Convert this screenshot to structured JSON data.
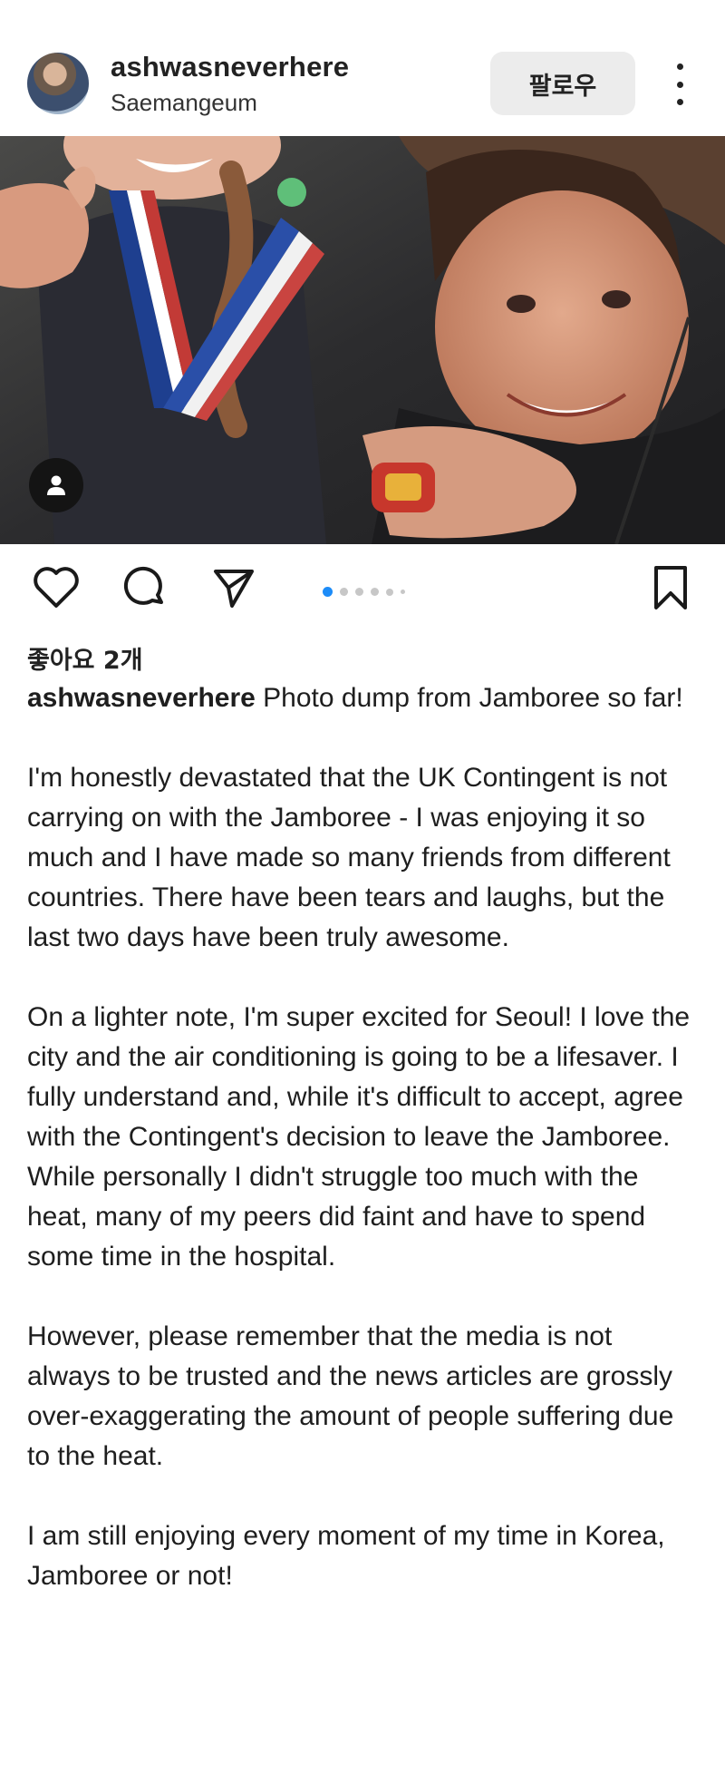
{
  "post": {
    "username": "ashwasneverhere",
    "location": "Saemangeum",
    "follow_label": "팔로우",
    "likes_text": "좋아요 2개",
    "carousel": {
      "count": 6,
      "active_index": 0
    }
  },
  "icons": {
    "avatar": "profile-photo",
    "more": "more-vertical-icon",
    "user_tag": "user-tag-icon",
    "like": "heart-icon",
    "comment": "comment-icon",
    "share": "send-icon",
    "save": "bookmark-icon"
  },
  "caption": {
    "user": "ashwasneverhere",
    "first_line_rest": " Photo dump from Jamboree so far!",
    "paragraphs": [
      "I'm honestly devastated that the UK Contingent is not carrying on with the Jamboree - I was enjoying it so much and I have made so many friends from different countries. There have been tears and laughs, but the last two days have been truly awesome.",
      "On a lighter note, I'm super excited for Seoul! I love the city and the air conditioning is going to be a lifesaver. I fully understand and, while it's difficult to accept, agree with the Contingent's decision to leave the Jamboree. While personally I didn't struggle too much with the heat, many of my peers did faint and have to spend some time in the hospital.",
      "However, please remember that the media is not always to be trusted and the news articles are grossly over-exaggerating the amount of people suffering due to the heat.",
      "I am still enjoying every moment of my time in Korea, Jamboree or not!"
    ]
  },
  "colors": {
    "accent_dot": "#1d8cf8",
    "text": "#1e1e1e",
    "follow_bg": "#ececec"
  }
}
